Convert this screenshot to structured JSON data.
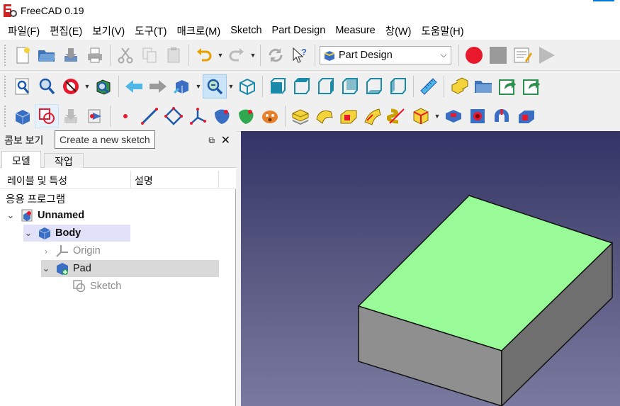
{
  "window": {
    "title": "FreeCAD 0.19"
  },
  "menu": [
    "파일(F)",
    "편집(E)",
    "보기(V)",
    "도구(T)",
    "매크로(M)",
    "Sketch",
    "Part Design",
    "Measure",
    "창(W)",
    "도움말(H)"
  ],
  "toolbar": {
    "workbench_selector": "Part Design"
  },
  "tooltip": "Create a new sketch",
  "combo_view": {
    "title": "콤보 보기",
    "tabs": [
      "모델",
      "작업"
    ],
    "columns": [
      "레이블 및 특성",
      "설명"
    ],
    "root_label": "응용 프로그램",
    "tree": [
      {
        "label": "Unnamed",
        "icon": "document-icon"
      },
      {
        "label": "Body",
        "icon": "body-icon"
      },
      {
        "label": "Origin",
        "icon": "origin-icon"
      },
      {
        "label": "Pad",
        "icon": "pad-icon"
      },
      {
        "label": "Sketch",
        "icon": "sketch-icon"
      }
    ]
  },
  "colors": {
    "selection_face": "#98fb98",
    "box_side": "#8c8c8c",
    "viewport_top": "#333366",
    "viewport_bottom": "#7a7aa0"
  }
}
